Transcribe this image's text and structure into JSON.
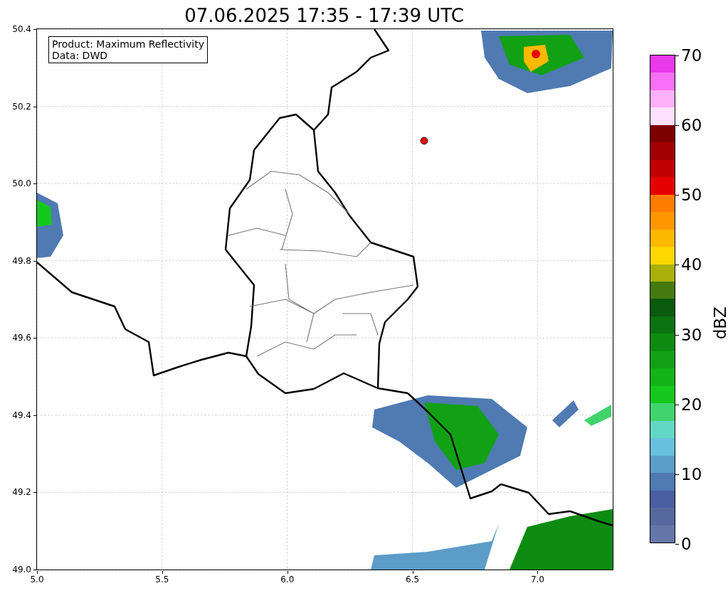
{
  "title": "07.06.2025 17:35 - 17:39 UTC",
  "info_box": {
    "lines": [
      "Product: Maximum Reflectivity",
      "Data: DWD"
    ]
  },
  "axes": {
    "xticks": [
      "5.0",
      "5.5",
      "6.0",
      "6.5",
      "7.0"
    ],
    "yticks": [
      "50.4",
      "50.2",
      "50.0",
      "49.8",
      "49.6",
      "49.4",
      "49.2",
      "49.0"
    ]
  },
  "colorbar": {
    "label": "dBZ",
    "ticks": [
      "70",
      "60",
      "50",
      "40",
      "30",
      "20",
      "10",
      "0"
    ],
    "bands": [
      {
        "color": "#6577a9"
      },
      {
        "color": "#55699f"
      },
      {
        "color": "#4a5ea0"
      },
      {
        "color": "#4f7ab2"
      },
      {
        "color": "#5b9dc8"
      },
      {
        "color": "#66c0de"
      },
      {
        "color": "#62d8c4"
      },
      {
        "color": "#42d46c"
      },
      {
        "color": "#15c81e"
      },
      {
        "color": "#12b418"
      },
      {
        "color": "#12a114"
      },
      {
        "color": "#0e8c12"
      },
      {
        "color": "#0b7212"
      },
      {
        "color": "#0a5a10"
      },
      {
        "color": "#457a10"
      },
      {
        "color": "#aab00a"
      },
      {
        "color": "#fdd700"
      },
      {
        "color": "#fdb800"
      },
      {
        "color": "#fd9600"
      },
      {
        "color": "#fe7c00"
      },
      {
        "color": "#e40000"
      },
      {
        "color": "#c00000"
      },
      {
        "color": "#a00000"
      },
      {
        "color": "#7c0000"
      },
      {
        "color": "#ffe0ff"
      },
      {
        "color": "#ffb0f8"
      },
      {
        "color": "#f870f8"
      },
      {
        "color": "#e838e8"
      }
    ]
  }
}
